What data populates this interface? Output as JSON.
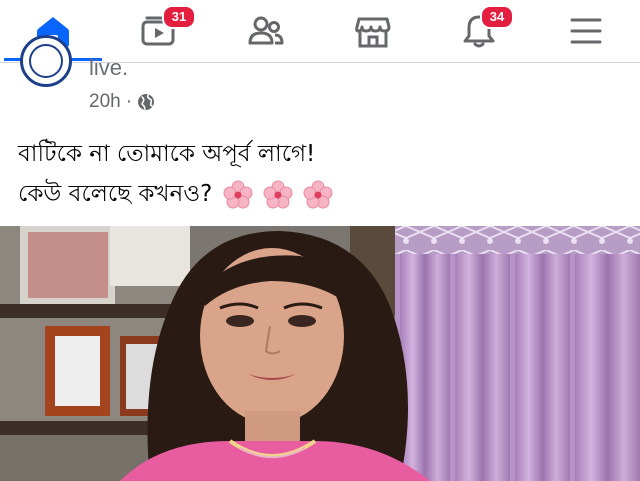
{
  "navbar": {
    "items": [
      {
        "name": "home",
        "active": true
      },
      {
        "name": "video",
        "badge": "31"
      },
      {
        "name": "friends"
      },
      {
        "name": "marketplace"
      },
      {
        "name": "notifications",
        "badge": "34"
      },
      {
        "name": "menu"
      }
    ]
  },
  "post": {
    "author_fragment": "live.",
    "time": "20h",
    "separator": "·",
    "privacy_icon": "globe-icon",
    "text_line1": "বাটিকে না তোমাকে অপূর্ব লাগে!",
    "text_line2": "কেউ বলেছে কখনও?",
    "emoji": [
      "cherry-blossom",
      "cherry-blossom",
      "cherry-blossom"
    ]
  },
  "colors": {
    "accent": "#0866ff",
    "badge": "#e41e3f",
    "icon": "#65676b",
    "text": "#050505"
  }
}
